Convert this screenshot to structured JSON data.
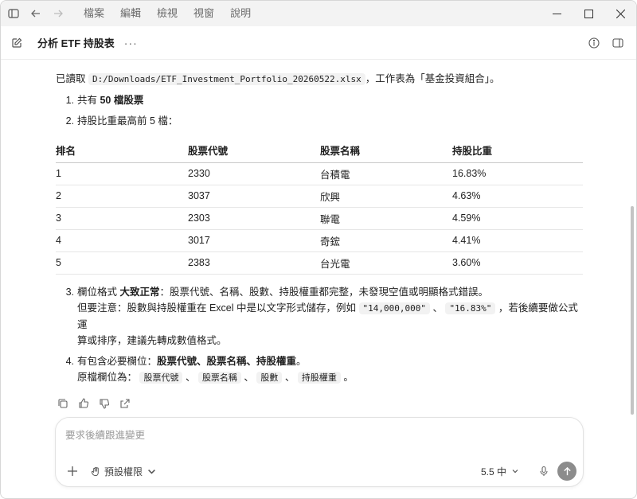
{
  "titlebar": {
    "menu": [
      "檔案",
      "編輯",
      "檢視",
      "視窗",
      "說明"
    ]
  },
  "header": {
    "title": "分析 ETF 持股表",
    "more": "···"
  },
  "message": {
    "intro_prefix": "已讀取 ",
    "intro_path": "D:/Downloads/ETF_Investment_Portfolio_20260522.xlsx",
    "intro_suffix": "，工作表為「基金投資組合」。",
    "item1_num": "1.",
    "item1_prefix": "共有 ",
    "item1_bold": "50 檔股票",
    "item2_num": "2.",
    "item2_text": "持股比重最高前 5 檔：",
    "table": {
      "headers": [
        "排名",
        "股票代號",
        "股票名稱",
        "持股比重"
      ],
      "rows": [
        [
          "1",
          "2330",
          "台積電",
          "16.83%"
        ],
        [
          "2",
          "3037",
          "欣興",
          "4.63%"
        ],
        [
          "3",
          "2303",
          "聯電",
          "4.59%"
        ],
        [
          "4",
          "3017",
          "奇鋐",
          "4.41%"
        ],
        [
          "5",
          "2383",
          "台光電",
          "3.60%"
        ]
      ]
    },
    "item3_num": "3.",
    "item3_prefix": "欄位格式 ",
    "item3_bold": "大致正常",
    "item3_rest": "：股票代號、名稱、股數、持股權重都完整，未發現空值或明顯格式錯誤。",
    "item3_line2_a": "但要注意：股數與持股權重在 Excel 中是以文字形式儲存，例如 ",
    "item3_code1": "\"14,000,000\"",
    "item3_sep": " 、 ",
    "item3_code2": "\"16.83%\"",
    "item3_line2_b": " ，若後續要做公式運",
    "item3_line3": "算或排序，建議先轉成數值格式。",
    "item4_num": "4.",
    "item4_prefix": "有包含必要欄位：",
    "item4_bold": "股票代號、股票名稱、持股權重",
    "item4_suffix": "。",
    "item4_line2_prefix": "原檔欄位為： ",
    "item4_fields": [
      "股票代號",
      "股票名稱",
      "股數",
      "持股權重"
    ],
    "item4_field_sep": " 、 ",
    "item4_line2_suffix": " 。"
  },
  "composer": {
    "placeholder": "要求後續跟進變更",
    "permission_label": "預設權限",
    "model_label": "5.5 中"
  },
  "icons": {
    "sidebar": "sidebar-icon",
    "back": "arrow-left-icon",
    "forward": "arrow-right-icon",
    "edit": "compose-icon",
    "info": "info-icon",
    "panel": "panel-icon",
    "copy": "copy-icon",
    "thumbs_up": "thumbs-up-icon",
    "thumbs_down": "thumbs-down-icon",
    "share": "share-icon",
    "plus": "plus-icon",
    "hand": "hand-icon",
    "mic": "mic-icon",
    "send": "arrow-up-icon"
  }
}
